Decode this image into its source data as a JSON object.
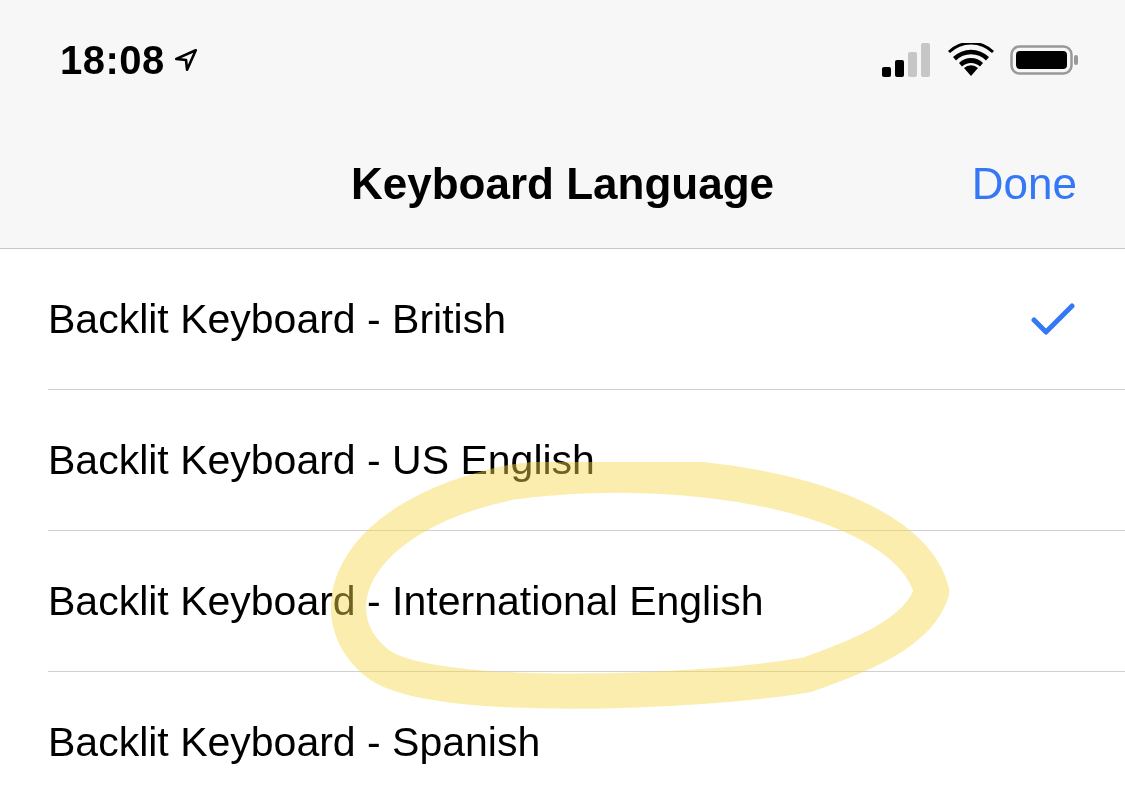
{
  "status_bar": {
    "time": "18:08"
  },
  "nav_bar": {
    "title": "Keyboard Language",
    "done": "Done"
  },
  "rows": [
    {
      "label": "Backlit Keyboard - British",
      "selected": true
    },
    {
      "label": "Backlit Keyboard - US English",
      "selected": false
    },
    {
      "label": "Backlit Keyboard - International English",
      "selected": false
    },
    {
      "label": "Backlit Keyboard - Spanish",
      "selected": false
    }
  ]
}
